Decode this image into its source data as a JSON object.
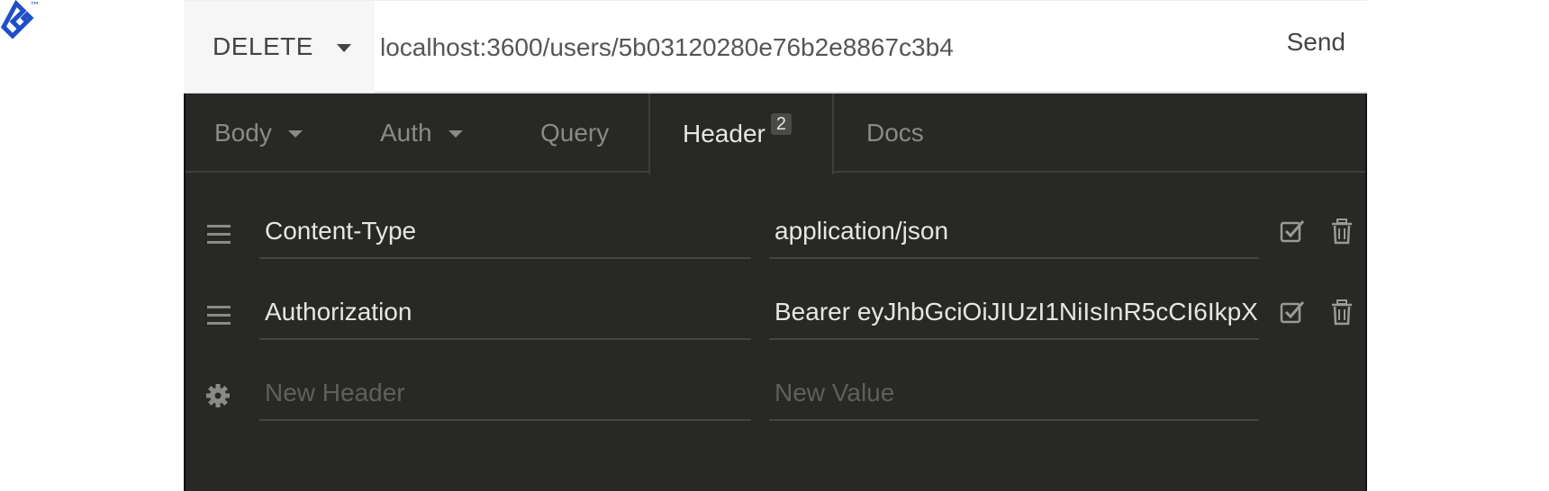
{
  "logo": {
    "tm": "™"
  },
  "request": {
    "method": "DELETE",
    "url": "localhost:3600/users/5b03120280e76b2e8867c3b4",
    "send_label": "Send"
  },
  "tabs": {
    "body": "Body",
    "auth": "Auth",
    "query": "Query",
    "header": "Header",
    "header_count": "2",
    "docs": "Docs"
  },
  "headers": [
    {
      "name": "Content-Type",
      "value": "application/json"
    },
    {
      "name": "Authorization",
      "value": "Bearer eyJhbGciOiJIUzI1NiIsInR5cCI6IkpX"
    }
  ],
  "new_header": {
    "name_placeholder": "New Header",
    "value_placeholder": "New Value"
  },
  "colors": {
    "panel_bg": "#282824",
    "logo": "#1f4fc8"
  },
  "icons": {
    "logo": "toptal-logo-icon",
    "method_caret": "chevron-down-icon",
    "drag": "drag-handle-icon",
    "settings": "gear-icon",
    "enable": "checkbox-checked-icon",
    "delete": "trash-icon"
  }
}
